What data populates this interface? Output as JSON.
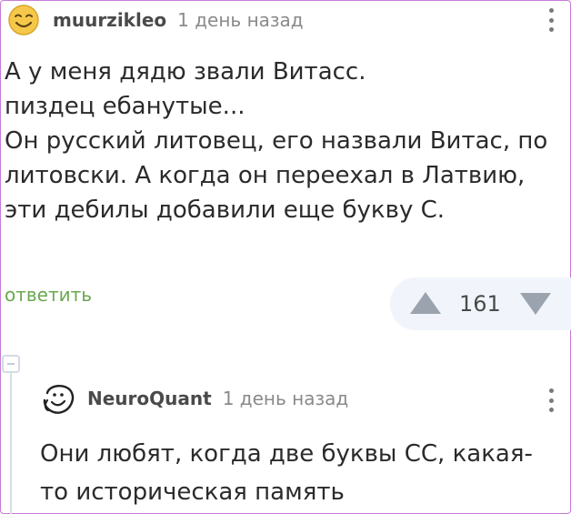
{
  "comment1": {
    "author": "muurzikleo",
    "time": "1 день назад",
    "lines": [
      "А у меня дядю звали Витасс.",
      "пиздец ебанутые...",
      "Он русский литовец, его назвали Витас, по",
      "литовски. А когда он переехал в Латвию,",
      "эти дебилы добавили еще букву С."
    ],
    "reply_label": "ответить",
    "score": "161",
    "avatar_icon": "smiley-icon"
  },
  "comment2": {
    "author": "NeuroQuant",
    "time": "1 день назад",
    "lines": [
      "Они любят, когда две буквы СС, какая-",
      "то историческая память"
    ],
    "avatar_icon": "doodle-face-icon"
  },
  "colors": {
    "reply_link": "#6aa84f",
    "vote_bg": "#f1f5fb",
    "vote_arrow": "#9aa3ae",
    "frame": "#c77ad6"
  }
}
